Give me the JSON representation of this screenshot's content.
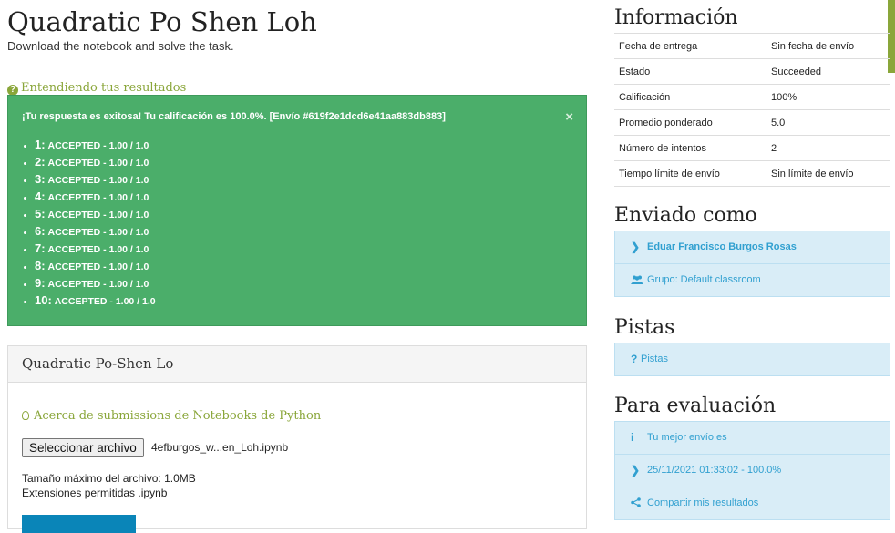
{
  "header": {
    "title": "Quadratic Po Shen Loh",
    "subtitle": "Download the notebook and solve the task."
  },
  "results": {
    "understand_link": "Entendiendo tus resultados",
    "message": "¡Tu respuesta es exitosa! Tu calificación es 100.0%. [Envío #619f2e1dcd6e41aa883db883]",
    "close_glyph": "×",
    "items": [
      {
        "num": "1:",
        "result": "ACCEPTED",
        "score": " - 1.00 / 1.0"
      },
      {
        "num": "2:",
        "result": "ACCEPTED",
        "score": " - 1.00 / 1.0"
      },
      {
        "num": "3:",
        "result": "ACCEPTED",
        "score": " - 1.00 / 1.0"
      },
      {
        "num": "4:",
        "result": "ACCEPTED",
        "score": " - 1.00 / 1.0"
      },
      {
        "num": "5:",
        "result": "ACCEPTED",
        "score": " - 1.00 / 1.0"
      },
      {
        "num": "6:",
        "result": "ACCEPTED",
        "score": " - 1.00 / 1.0"
      },
      {
        "num": "7:",
        "result": "ACCEPTED",
        "score": " - 1.00 / 1.0"
      },
      {
        "num": "8:",
        "result": "ACCEPTED",
        "score": " - 1.00 / 1.0"
      },
      {
        "num": "9:",
        "result": "ACCEPTED",
        "score": " - 1.00 / 1.0"
      },
      {
        "num": "10:",
        "result": "ACCEPTED",
        "score": " - 1.00 / 1.0"
      }
    ]
  },
  "submission_panel": {
    "title": "Quadratic Po-Shen Lo",
    "about_link": "Acerca de submissions de Notebooks de Python",
    "file_button": "Seleccionar archivo",
    "file_name": "4efburgos_w...en_Loh.ipynb",
    "max_size": "Tamaño máximo del archivo: 1.0MB",
    "allowed_ext": "Extensiones permitidas .ipynb"
  },
  "info": {
    "heading": "Información",
    "rows": [
      {
        "label": "Fecha de entrega",
        "value": "Sin fecha de envío"
      },
      {
        "label": "Estado",
        "value": "Succeeded"
      },
      {
        "label": "Calificación",
        "value": "100%"
      },
      {
        "label": "Promedio ponderado",
        "value": "5.0"
      },
      {
        "label": "Número de intentos",
        "value": "2"
      },
      {
        "label": "Tiempo límite de envío",
        "value": "Sin límite de envío"
      }
    ]
  },
  "sent_as": {
    "heading": "Enviado como",
    "user": "Eduar Francisco Burgos Rosas",
    "group": "Grupo: Default classroom"
  },
  "hints": {
    "heading": "Pistas",
    "link": "Pistas",
    "icon": "?"
  },
  "evaluation": {
    "heading": "Para evaluación",
    "best_label": "Tu mejor envío es",
    "best_value": "25/11/2021 01:33:02 - 100.0%",
    "share": "Compartir mis resultados",
    "info_icon": "i"
  },
  "icons": {
    "chevron": "❯",
    "users": "people-icon",
    "share": "share-icon"
  },
  "colors": {
    "success_bg": "#4bae6a",
    "accent_green": "#8aa63a",
    "info_bg": "#d9edf7",
    "info_text": "#31a0d0",
    "primary_button": "#0a85b8"
  }
}
